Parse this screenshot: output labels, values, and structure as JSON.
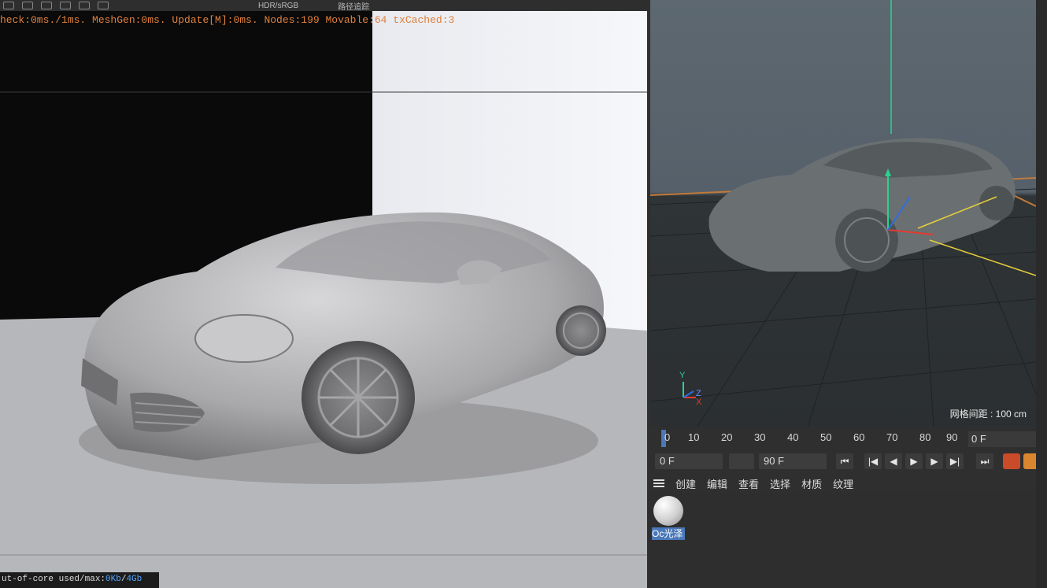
{
  "render_view": {
    "stats_text": "heck:0ms./1ms. MeshGen:0ms. Update[M]:0ms. Nodes:199 Movable:64 txCached:3",
    "toolbar": {
      "color_space": "HDR/sRGB",
      "render_mode": "路径追踪"
    },
    "out_of_core": {
      "label": "ut-of-core used/max:",
      "value": "0Kb",
      "sep": "/",
      "max": "4Gb"
    }
  },
  "viewport": {
    "grid_spacing": "网格间距 : 100 cm",
    "axis_labels": {
      "y": "Y",
      "z": "Z",
      "x": "X"
    }
  },
  "timeline": {
    "ticks": [
      "0",
      "10",
      "20",
      "30",
      "40",
      "50",
      "60",
      "70",
      "80",
      "90"
    ],
    "current_frame": "0 F"
  },
  "transport": {
    "start_field": "0 F",
    "end_field": "90 F",
    "buttons": {
      "go_start": "⏮",
      "prev_key": "|◀",
      "prev_frame": "◀",
      "play": "▶",
      "next_frame": "▶",
      "next_key": "▶|",
      "go_end": "⏭"
    }
  },
  "material_manager": {
    "menu": [
      "创建",
      "编辑",
      "查看",
      "选择",
      "材质",
      "纹理"
    ],
    "material": {
      "name": "Oc光泽"
    }
  },
  "colors": {
    "accent_orange": "#e0803c",
    "selection_blue": "#4a78b8",
    "grid_green": "#2bd18f"
  }
}
